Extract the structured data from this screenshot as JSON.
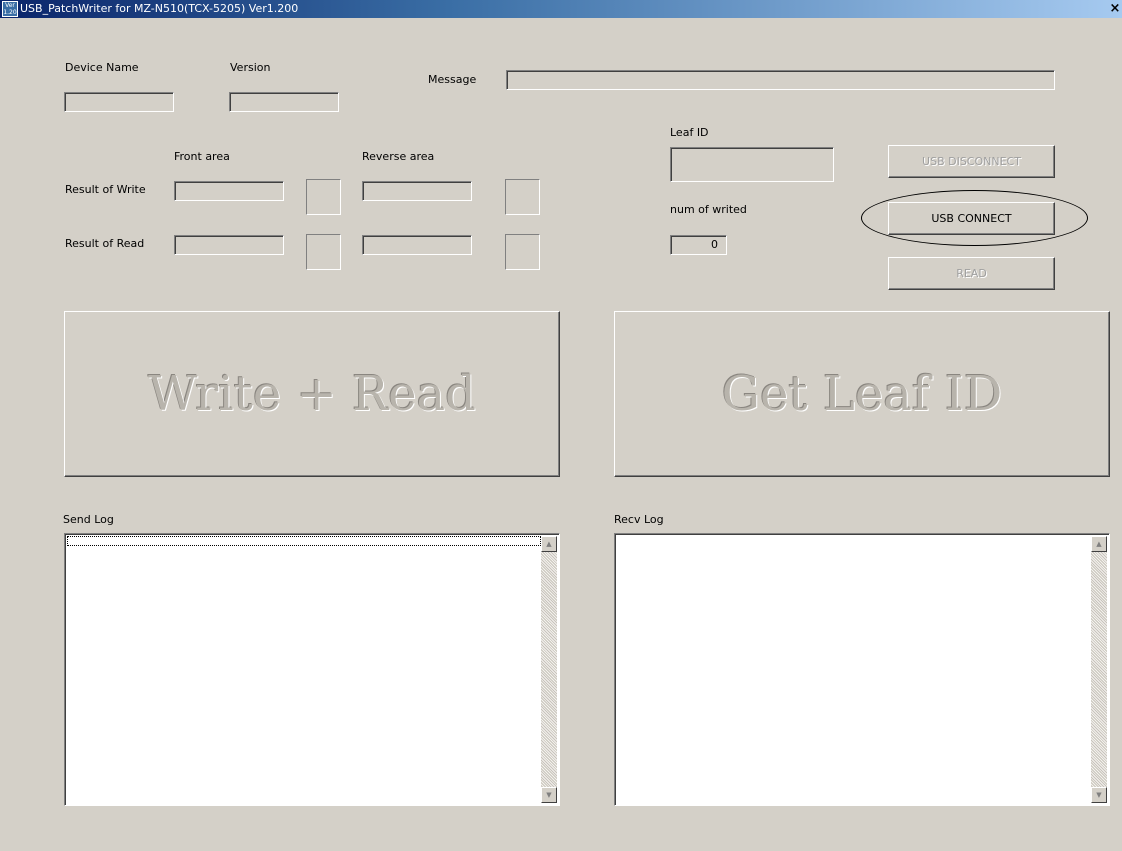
{
  "window": {
    "icon_text": "Ver 1.20",
    "title": "USB_PatchWriter for MZ-N510(TCX-5205) Ver1.200",
    "close_glyph": "×",
    "close_icon": "close-icon"
  },
  "device": {
    "name_label": "Device Name",
    "name_value": "",
    "version_label": "Version",
    "version_value": ""
  },
  "message": {
    "label": "Message",
    "value": ""
  },
  "areas": {
    "front_label": "Front area",
    "reverse_label": "Reverse area"
  },
  "results": {
    "write_label": "Result of Write",
    "read_label": "Result of Read",
    "write_front": "",
    "write_reverse": "",
    "read_front": "",
    "read_reverse": ""
  },
  "leaf": {
    "id_label": "Leaf ID",
    "id_value": "",
    "num_label": "num of writed",
    "num_value": "0"
  },
  "buttons": {
    "usb_disconnect": "USB DISCONNECT",
    "usb_connect": "USB CONNECT",
    "read": "READ",
    "write_read": "Write + Read",
    "get_leaf_id": "Get Leaf ID"
  },
  "logs": {
    "send_label": "Send Log",
    "recv_label": "Recv Log"
  },
  "scrollbar": {
    "up_glyph": "▲",
    "down_glyph": "▼",
    "up_icon": "scroll-up-arrow-icon",
    "down_icon": "scroll-down-arrow-icon"
  },
  "annotation": {
    "shape": "ellipse",
    "target": "USB CONNECT"
  }
}
